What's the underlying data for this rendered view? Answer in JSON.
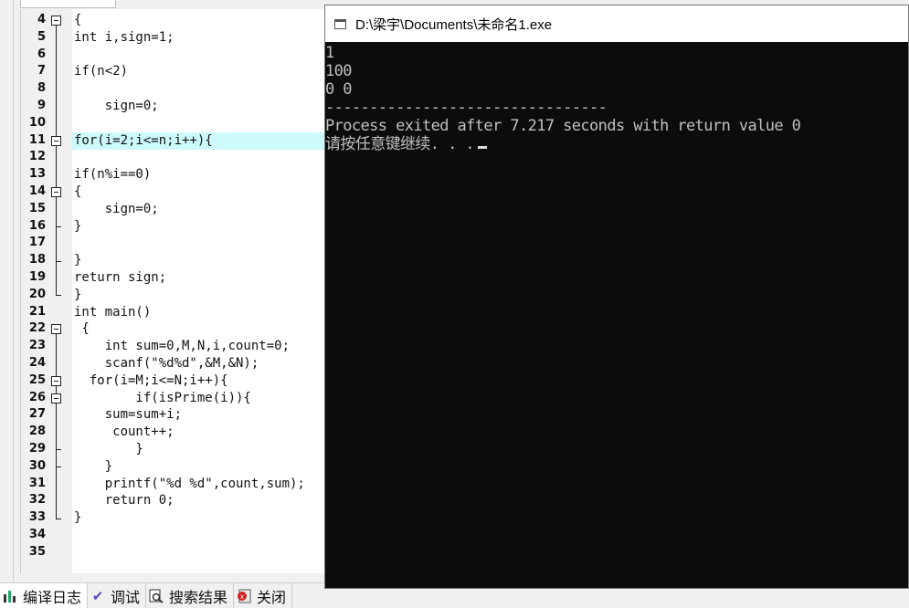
{
  "editor": {
    "highlighted_line": 11,
    "lines": [
      {
        "n": "4",
        "text": "{"
      },
      {
        "n": "5",
        "text": "int i,sign=1;"
      },
      {
        "n": "6",
        "text": ""
      },
      {
        "n": "7",
        "text": "if(n<2)"
      },
      {
        "n": "8",
        "text": ""
      },
      {
        "n": "9",
        "text": "    sign=0;"
      },
      {
        "n": "10",
        "text": ""
      },
      {
        "n": "11",
        "text": "for(i=2;i<=n;i++){"
      },
      {
        "n": "12",
        "text": ""
      },
      {
        "n": "13",
        "text": "if(n%i==0)"
      },
      {
        "n": "14",
        "text": "{"
      },
      {
        "n": "15",
        "text": "    sign=0;"
      },
      {
        "n": "16",
        "text": "}"
      },
      {
        "n": "17",
        "text": ""
      },
      {
        "n": "18",
        "text": "}"
      },
      {
        "n": "19",
        "text": "return sign;"
      },
      {
        "n": "20",
        "text": "}"
      },
      {
        "n": "21",
        "text": "int main()"
      },
      {
        "n": "22",
        "text": " {"
      },
      {
        "n": "23",
        "text": "    int sum=0,M,N,i,count=0;"
      },
      {
        "n": "24",
        "text": "    scanf(\"%d%d\",&M,&N);"
      },
      {
        "n": "25",
        "text": "  for(i=M;i<=N;i++){"
      },
      {
        "n": "26",
        "text": "        if(isPrime(i)){"
      },
      {
        "n": "27",
        "text": "    sum=sum+i;"
      },
      {
        "n": "28",
        "text": "     count++;"
      },
      {
        "n": "29",
        "text": "        }"
      },
      {
        "n": "30",
        "text": "    }"
      },
      {
        "n": "31",
        "text": "    printf(\"%d %d\",count,sum);"
      },
      {
        "n": "32",
        "text": "    return 0;"
      },
      {
        "n": "33",
        "text": "}"
      },
      {
        "n": "34",
        "text": ""
      },
      {
        "n": "35",
        "text": ""
      }
    ]
  },
  "console": {
    "title": "D:\\梁宇\\Documents\\未命名1.exe",
    "output": [
      "1",
      "100",
      "0 0",
      "--------------------------------",
      "Process exited after 7.217 seconds with return value 0"
    ],
    "prompt": "请按任意键继续. . ."
  },
  "bottom_tabs": [
    {
      "label": "编译日志",
      "icon": "chart-icon"
    },
    {
      "label": "调试",
      "icon": "check-icon"
    },
    {
      "label": "搜索结果",
      "icon": "search-icon"
    },
    {
      "label": "关闭",
      "icon": "close-icon"
    }
  ],
  "colors": {
    "punct": "#d02020",
    "number": "#9020a0",
    "string": "#1a3acc",
    "highlight": "#ccfafa",
    "console_bg": "#0c0c0c"
  }
}
